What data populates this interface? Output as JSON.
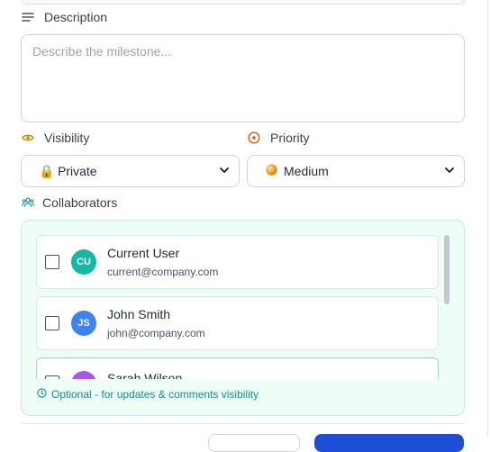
{
  "description": {
    "label": "Description",
    "placeholder": "Describe the milestone...",
    "value": ""
  },
  "visibility": {
    "label": "Visibility",
    "selected_icon": "🔒",
    "selected": "Private"
  },
  "priority": {
    "label": "Priority",
    "selected_icon": "🟡",
    "selected": "Medium"
  },
  "collaborators": {
    "label": "Collaborators",
    "items": [
      {
        "initials": "CU",
        "name": "Current User",
        "email": "current@company.com",
        "avatar_color": "#14b8a6",
        "checked": false
      },
      {
        "initials": "JS",
        "name": "John Smith",
        "email": "john@company.com",
        "avatar_color": "#3b82f6",
        "checked": false
      },
      {
        "initials": "SW",
        "name": "Sarah Wilson",
        "email": "",
        "avatar_color": "#a855f7",
        "checked": false
      }
    ],
    "hint": "Optional - for updates & comments visibility"
  },
  "colors": {
    "accent_teal": "#0d9488",
    "visibility_icon": "#ca8a04",
    "priority_icon": "#ea580c",
    "primary_button": "#1d4ed8"
  },
  "icons": {
    "description": "lines-icon",
    "visibility": "eye-icon",
    "priority": "target-icon",
    "collaborators": "users-icon",
    "hint": "info-circle-icon",
    "select_arrow": "chevron-down-icon"
  }
}
